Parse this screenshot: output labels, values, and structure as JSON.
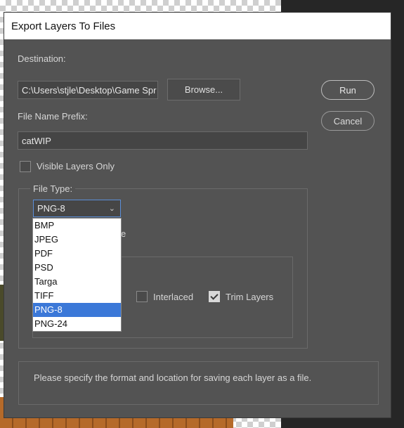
{
  "dialog": {
    "title": "Export Layers To Files",
    "destination_label": "Destination:",
    "destination_value": "C:\\Users\\stjle\\Desktop\\Game Spr",
    "browse_label": "Browse...",
    "prefix_label": "File Name Prefix:",
    "prefix_value": "catWIP",
    "visible_layers_label": "Visible Layers Only",
    "run_label": "Run",
    "cancel_label": "Cancel",
    "file_type": {
      "legend": "File Type:",
      "selected": "PNG-8",
      "options": [
        "BMP",
        "JPEG",
        "PDF",
        "PSD",
        "Targa",
        "TIFF",
        "PNG-8",
        "PNG-24"
      ],
      "hidden_option_tail": "e"
    },
    "interlaced_label": "Interlaced",
    "trim_layers_label": "Trim Layers",
    "info_text": "Please specify the format and location for saving each layer as a file."
  },
  "state": {
    "visible_layers_only": false,
    "interlaced": false,
    "trim_layers": true
  },
  "colors": {
    "dialog_bg": "#535353",
    "highlight": "#3b78d8"
  }
}
